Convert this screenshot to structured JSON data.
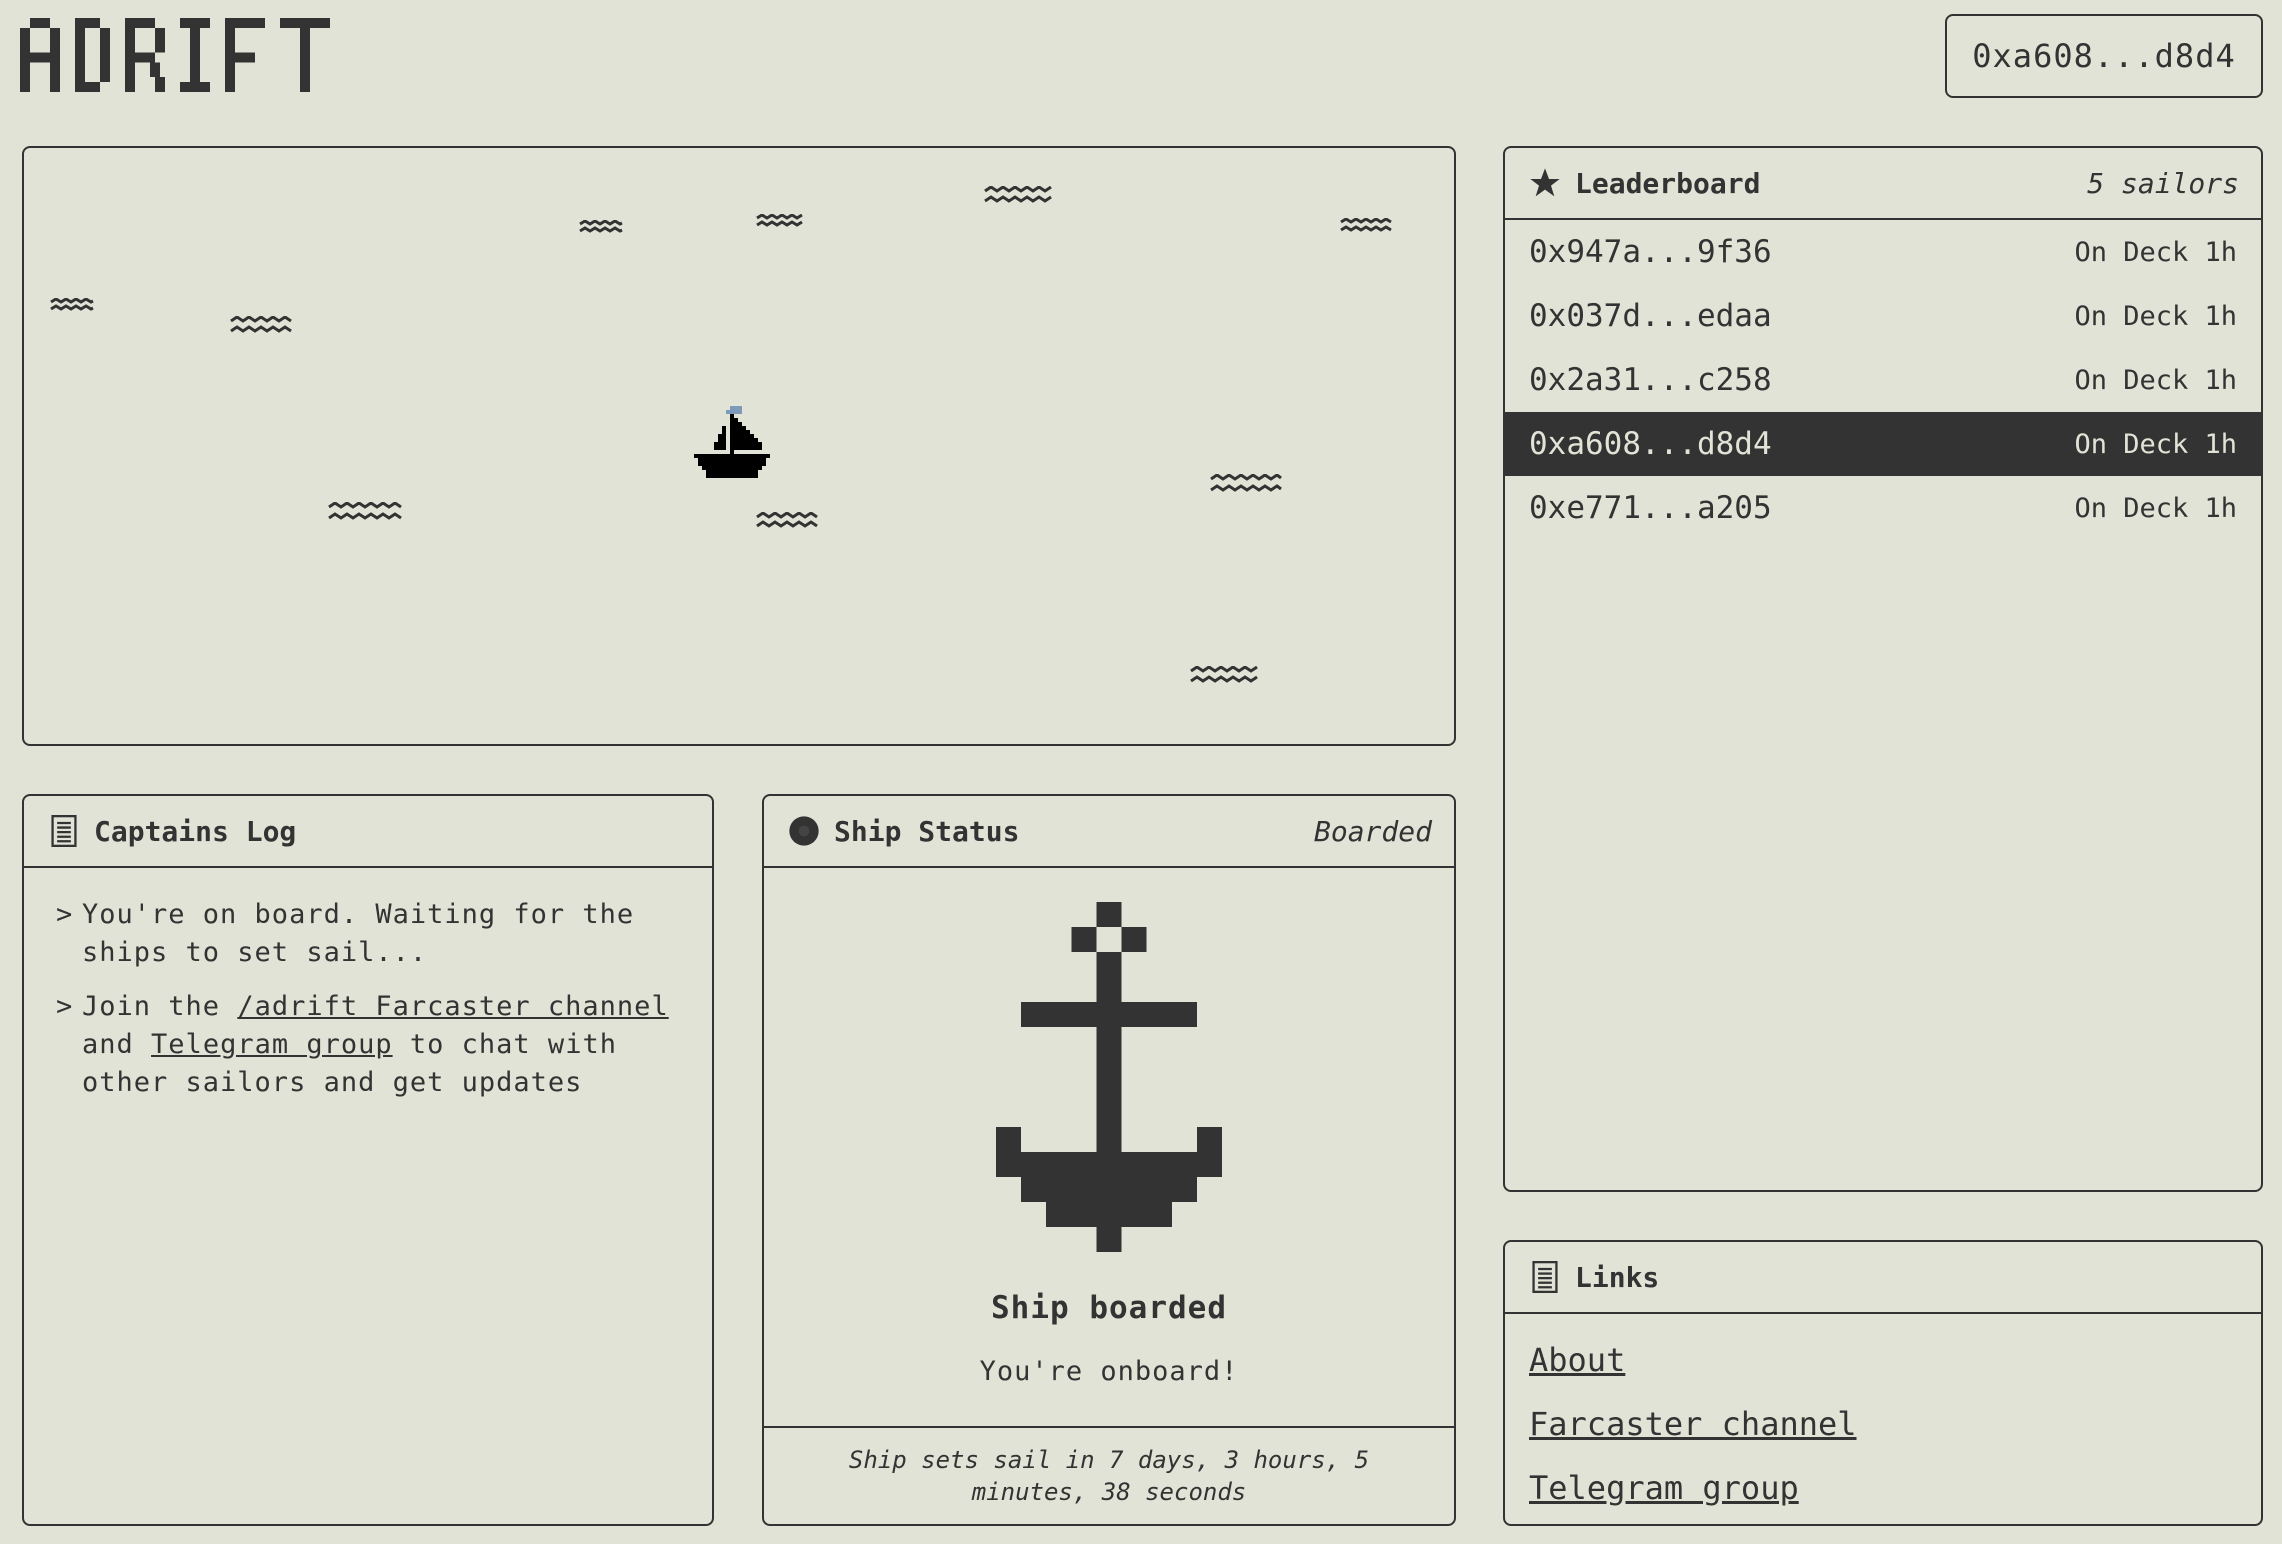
{
  "app": {
    "logo_text": "ADRIFT",
    "wallet_address": "0xa608...d8d4"
  },
  "colors": {
    "background": "#e2e3d7",
    "ink": "#333333",
    "flag": "#7d9bb8"
  },
  "sea": {
    "icons": [
      "wave-icon",
      "sailboat-icon"
    ]
  },
  "leaderboard": {
    "title": "Leaderboard",
    "count_label": "5 sailors",
    "icon": "star-icon",
    "rows": [
      {
        "address": "0x947a...9f36",
        "status": "On Deck 1h",
        "current": false
      },
      {
        "address": "0x037d...edaa",
        "status": "On Deck 1h",
        "current": false
      },
      {
        "address": "0x2a31...c258",
        "status": "On Deck 1h",
        "current": false
      },
      {
        "address": "0xa608...d8d4",
        "status": "On Deck 1h",
        "current": true
      },
      {
        "address": "0xe771...a205",
        "status": "On Deck 1h",
        "current": false
      }
    ]
  },
  "captains_log": {
    "title": "Captains Log",
    "icon": "document-icon",
    "caret": ">",
    "entry1": "You're on board. Waiting for the ships to set sail...",
    "entry2": {
      "prefix": "Join the",
      "link1": "/adrift Farcaster channel",
      "middle": "and",
      "link2": "Telegram group",
      "suffix": "to chat with other sailors and get updates"
    }
  },
  "ship_status": {
    "title": "Ship Status",
    "state": "Boarded",
    "icon": "circle-icon",
    "heading": "Ship boarded",
    "subtext": "You're onboard!",
    "countdown": "Ship sets sail in 7 days, 3 hours, 5 minutes, 38 seconds"
  },
  "links": {
    "title": "Links",
    "icon": "document-icon",
    "items": [
      "About",
      "Farcaster channel",
      "Telegram group"
    ]
  }
}
